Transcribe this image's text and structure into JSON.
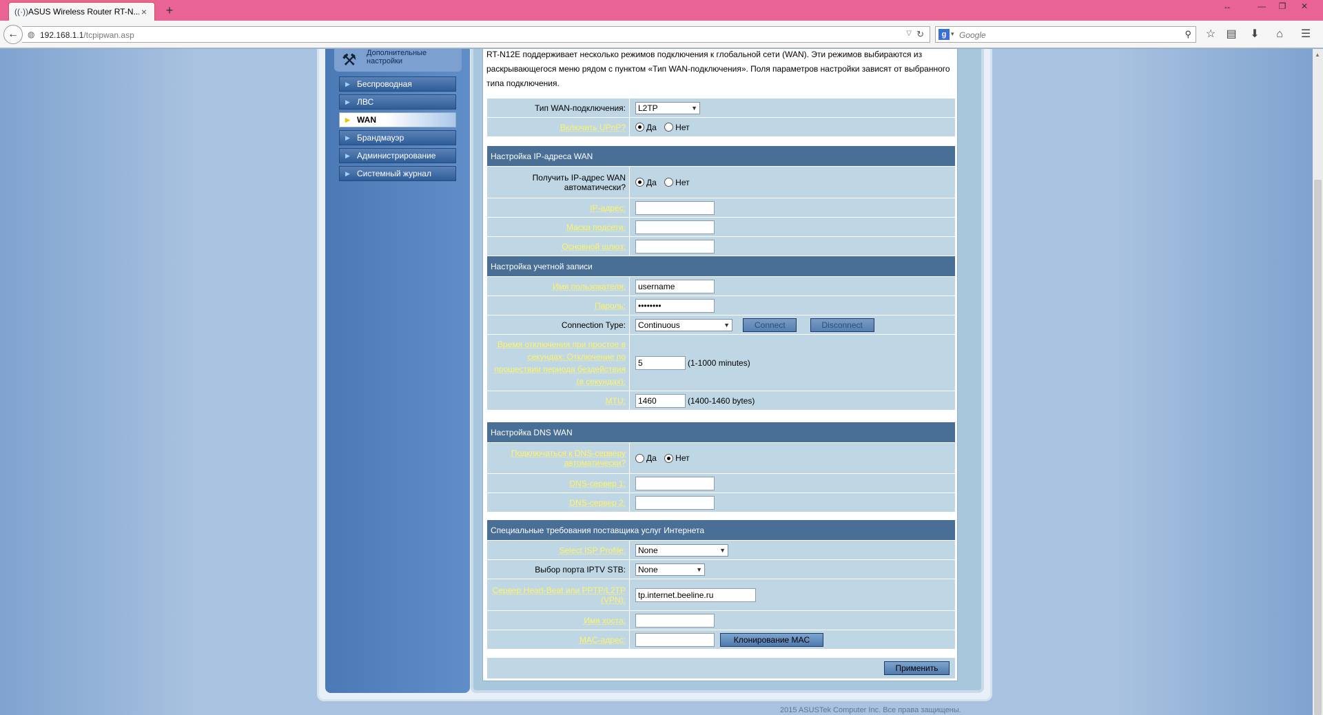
{
  "browser": {
    "tab_title": "ASUS Wireless Router RT-N...",
    "tab_close": "×",
    "new_tab": "+",
    "url_host": "192.168.1.1",
    "url_path": "/tcpipwan.asp",
    "search_engine": "g",
    "search_placeholder": "Google",
    "icons": [
      "star-icon",
      "reading-list-icon",
      "download-icon",
      "home-icon",
      "menu-icon"
    ]
  },
  "sidebar": {
    "header": "Дополнительные настройки",
    "items": [
      {
        "label": "Беспроводная"
      },
      {
        "label": "ЛВС"
      },
      {
        "label": "WAN"
      },
      {
        "label": "Брандмауэр"
      },
      {
        "label": "Администрирование"
      },
      {
        "label": "Системный журнал"
      }
    ]
  },
  "intro": "RT-N12E поддерживает несколько режимов подключения к глобальной сети (WAN). Эти режимов выбираются из раскрывающегося меню рядом с пунктом «Тип WAN-подключения». Поля параметров настройки зависят от выбранного типа подключения.",
  "wan_type": {
    "label": "Тип WAN-подключения:",
    "value": "L2TP",
    "upnp_label": "Включить UPnP?",
    "yes": "Да",
    "no": "Нет"
  },
  "ip_section": {
    "title": "Настройка IP-адреса WAN",
    "auto_label": "Получить IP-адрес WAN автоматически?",
    "ip_label": "IP-адрес:",
    "mask_label": "Маска подсети:",
    "gateway_label": "Основной шлюз:"
  },
  "account_section": {
    "title": "Настройка учетной записи",
    "username_label": "Имя пользователя:",
    "username_value": "username",
    "password_label": "Пароль:",
    "password_value": "••••••••",
    "conn_type_label": "Connection Type:",
    "conn_type_value": "Continuous",
    "connect_btn": "Connect",
    "disconnect_btn": "Disconnect",
    "idle_label": "Время отключения при простое в секундах: Отключение по прошествии периода бездействия (в секундах):",
    "idle_value": "5",
    "idle_hint": "(1-1000 minutes)",
    "mtu_label": "MTU:",
    "mtu_value": "1460",
    "mtu_hint": "(1400-1460 bytes)"
  },
  "dns_section": {
    "title": "Настройка DNS WAN",
    "auto_label": "Подключаться к DNS-серверу автоматически?",
    "dns1_label": "DNS-сервер 1:",
    "dns2_label": "DNS-сервер 2:"
  },
  "isp_section": {
    "title": "Специальные требования поставщика услуг Интернета",
    "isp_profile_label": "Select ISP Profile:",
    "isp_profile_value": "None",
    "iptv_label": "Выбор порта IPTV STB:",
    "iptv_value": "None",
    "heartbeat_label": "Сервер Heart-Beat или PPTP/L2TP (VPN):",
    "heartbeat_value": "tp.internet.beeline.ru",
    "hostname_label": "Имя хоста:",
    "mac_label": "MAC-адрес:",
    "mac_clone_btn": "Клонирование MAC"
  },
  "apply_btn": "Применить",
  "footer": "2015 ASUSTek Computer Inc. Все права защищены.",
  "colors": {
    "tabbar": "#e96394",
    "section_header": "#4a6f97",
    "row_bg": "#bfd7e4",
    "link_label": "#fff36a"
  }
}
